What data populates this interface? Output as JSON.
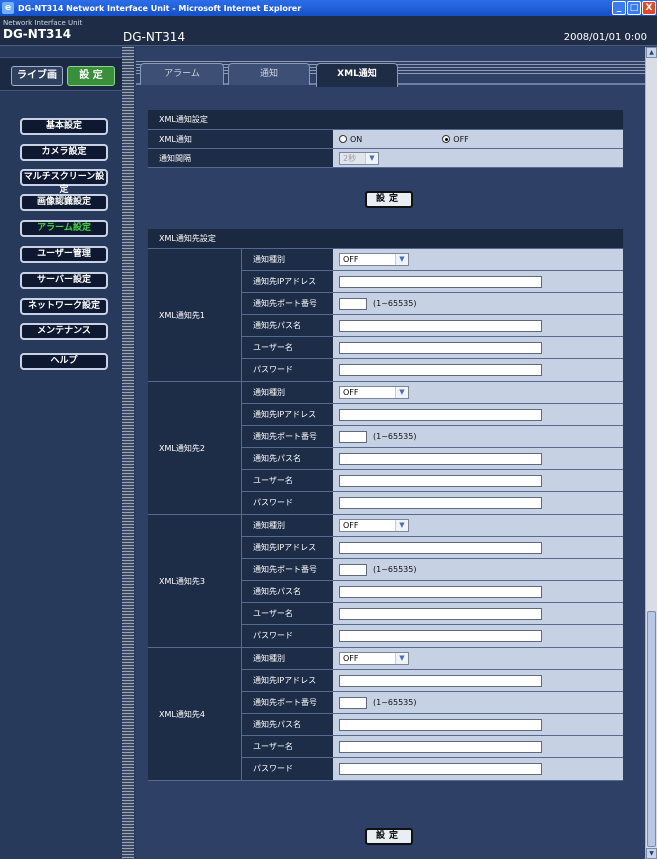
{
  "window": {
    "title": "DG-NT314 Network Interface Unit - Microsoft Internet Explorer",
    "icon": "e",
    "min": "_",
    "max": "□",
    "close": "X"
  },
  "header": {
    "brand_sub": "Network Interface Unit",
    "brand_main": "DG-NT314",
    "model": "DG-NT314",
    "datetime": "2008/01/01  0:00"
  },
  "mode": {
    "live": "ライブ画",
    "setup": "設 定"
  },
  "sidebar": {
    "items": [
      {
        "label": "基本設定"
      },
      {
        "label": "カメラ設定"
      },
      {
        "label": "マルチスクリーン設定"
      },
      {
        "label": "画像認識設定"
      },
      {
        "label": "アラーム設定",
        "active": true
      },
      {
        "label": "ユーザー管理"
      },
      {
        "label": "サーバー設定"
      },
      {
        "label": "ネットワーク設定"
      },
      {
        "label": "メンテナンス"
      },
      {
        "label": "ヘルプ"
      }
    ]
  },
  "tabs": [
    {
      "label": "アラーム"
    },
    {
      "label": "通知"
    },
    {
      "label": "XML通知",
      "selected": true
    }
  ],
  "xml_settings": {
    "header": "XML通知設定",
    "notify_label": "XML通知",
    "on_label": "ON",
    "off_label": "OFF",
    "selected": "OFF",
    "interval_label": "通知間隔",
    "interval_value": "2秒",
    "set_button": "設定"
  },
  "destinations": {
    "header": "XML通知先設定",
    "field_labels": {
      "type": "通知種別",
      "ip": "通知先IPアドレス",
      "port": "通知先ポート番号",
      "path": "通知先パス名",
      "user": "ユーザー名",
      "password": "パスワード"
    },
    "port_range": "(1~65535)",
    "items": [
      {
        "name": "XML通知先1",
        "type": "OFF"
      },
      {
        "name": "XML通知先2",
        "type": "OFF"
      },
      {
        "name": "XML通知先3",
        "type": "OFF"
      },
      {
        "name": "XML通知先4",
        "type": "OFF"
      }
    ],
    "set_button": "設定"
  },
  "scrollbar": {
    "up": "▲",
    "down": "▼"
  },
  "colors": {
    "accent_active": "#44d444",
    "setup_button": "#3a8f3a",
    "title_bar": "#2c6ee8"
  }
}
